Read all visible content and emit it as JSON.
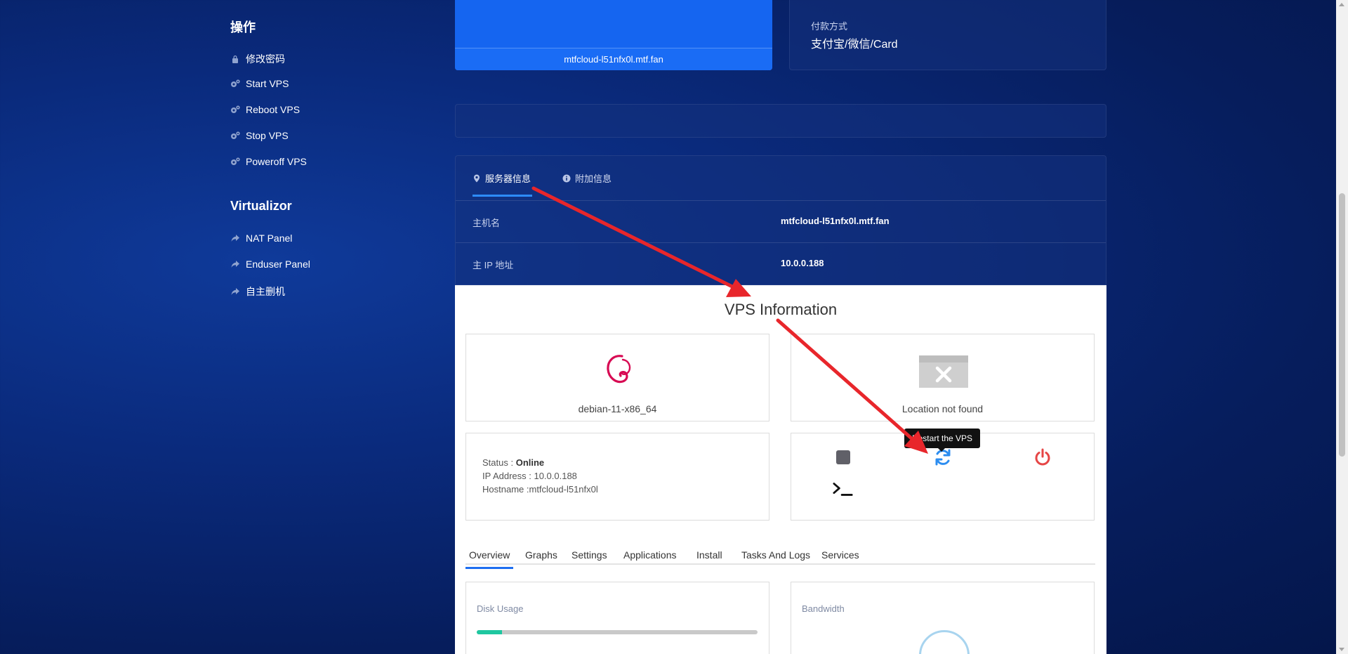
{
  "sidebar": {
    "actions_heading": "操作",
    "actions": [
      {
        "label": "修改密码",
        "icon": "lock-icon"
      },
      {
        "label": "Start VPS",
        "icon": "gears-icon"
      },
      {
        "label": "Reboot VPS",
        "icon": "gears-icon"
      },
      {
        "label": "Stop VPS",
        "icon": "gears-icon"
      },
      {
        "label": "Poweroff VPS",
        "icon": "gears-icon"
      }
    ],
    "virtualizor_heading": "Virtualizor",
    "links": [
      {
        "label": "NAT Panel",
        "icon": "share-icon"
      },
      {
        "label": "Enduser Panel",
        "icon": "share-icon"
      },
      {
        "label": "自主删机",
        "icon": "share-icon"
      }
    ]
  },
  "top_cards": {
    "hostname_footer": "mtfcloud-l51nfx0l.mtf.fan",
    "payment_label": "付款方式",
    "payment_value": "支付宝/微信/Card"
  },
  "server_info": {
    "tabs": [
      {
        "label": "服务器信息",
        "icon": "map-marker-icon",
        "active": true
      },
      {
        "label": "附加信息",
        "icon": "info-circle-icon",
        "active": false
      }
    ],
    "rows": [
      {
        "key": "主机名",
        "value": "mtfcloud-l51nfx0l.mtf.fan"
      },
      {
        "key": "主 IP 地址",
        "value": "10.0.0.188"
      }
    ]
  },
  "vps": {
    "title": "VPS Information",
    "os_name": "debian-11-x86_64",
    "location_text": "Location not found",
    "status_label": "Status : ",
    "status_value": "Online",
    "ip_label": "IP Address : ",
    "ip_value": "10.0.0.188",
    "hostname_label": "Hostname :",
    "hostname_value": "mtfcloud-l51nfx0l",
    "tooltip": "Restart the VPS",
    "tabs": [
      "Overview",
      "Graphs",
      "Settings",
      "Applications",
      "Install",
      "Tasks And Logs",
      "Services"
    ],
    "active_tab": "Overview",
    "disk_label": "Disk Usage",
    "disk_usage_fraction": 0.09,
    "bandwidth_label": "Bandwidth"
  },
  "colors": {
    "accent_blue": "#1e6ef0",
    "annotation_red": "#e8262b",
    "power_red": "#e64646",
    "disk_green": "#1fc7a0"
  }
}
